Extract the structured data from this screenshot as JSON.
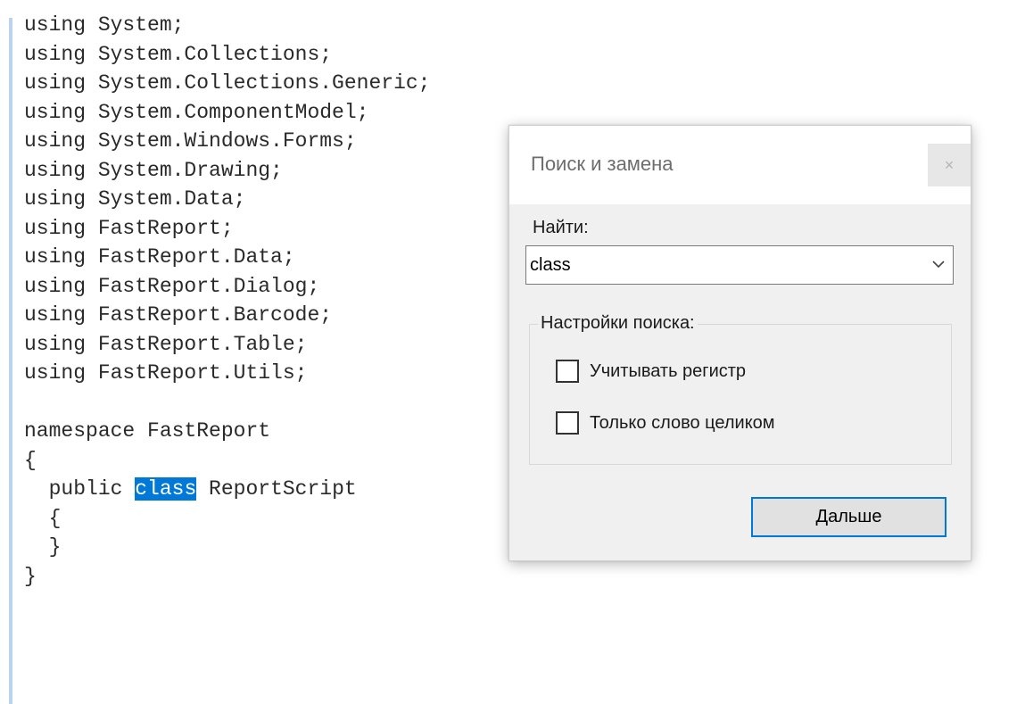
{
  "editor": {
    "code_lines": [
      "using System;",
      "using System.Collections;",
      "using System.Collections.Generic;",
      "using System.ComponentModel;",
      "using System.Windows.Forms;",
      "using System.Drawing;",
      "using System.Data;",
      "using FastReport;",
      "using FastReport.Data;",
      "using FastReport.Dialog;",
      "using FastReport.Barcode;",
      "using FastReport.Table;",
      "using FastReport.Utils;",
      "",
      "namespace FastReport",
      "{",
      "  public class ReportScript",
      "  {",
      "  }",
      "}"
    ],
    "highlighted_match": "class",
    "gutter_color": "#bcd3f0",
    "selection_color": "#0078d7"
  },
  "dialog": {
    "title": "Поиск и замена",
    "close_icon": "×",
    "find_label": "Найти:",
    "find_value": "class",
    "options_legend": "Настройки поиска:",
    "options": [
      {
        "label": "Учитывать регистр",
        "checked": false
      },
      {
        "label": "Только слово целиком",
        "checked": false
      }
    ],
    "next_button": "Дальше",
    "accent_color": "#0078d7"
  }
}
